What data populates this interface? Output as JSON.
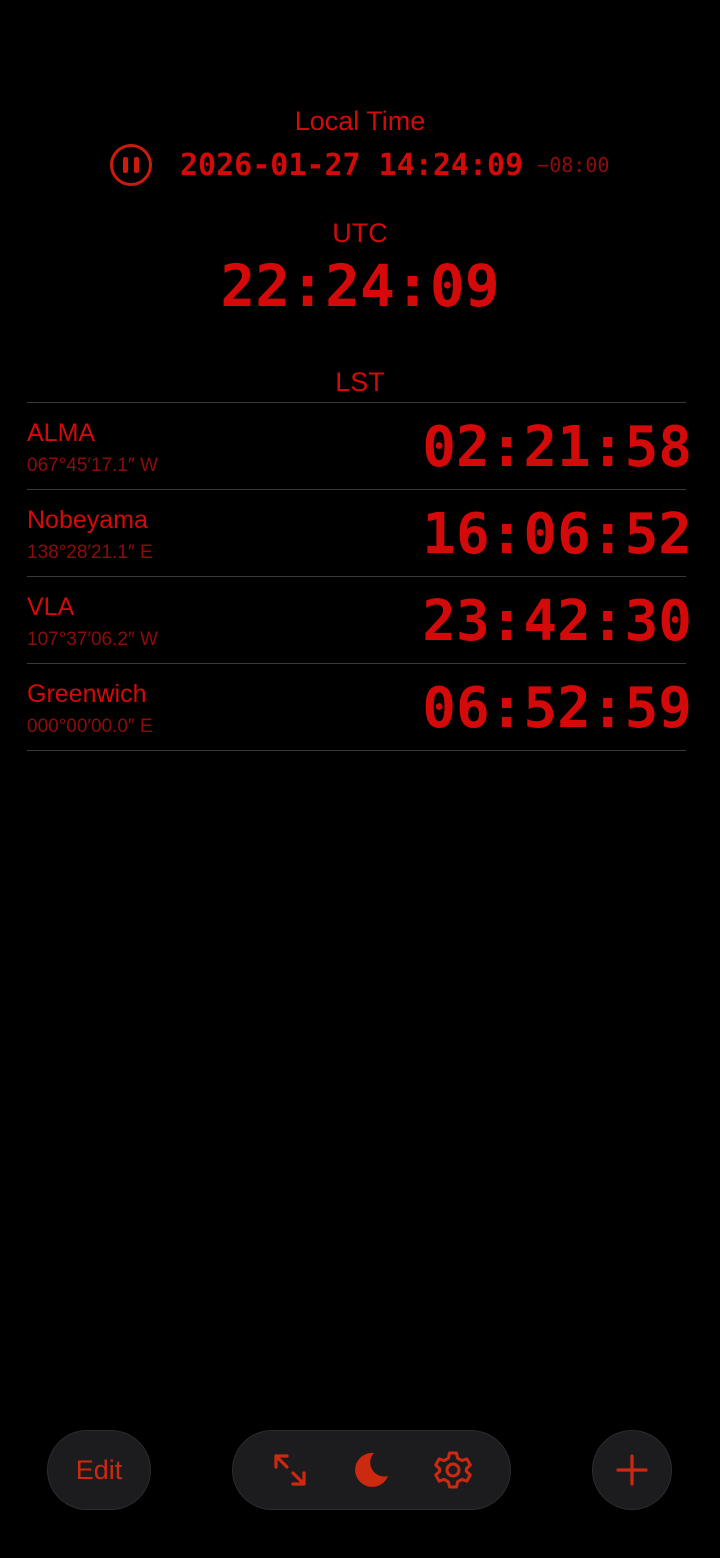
{
  "local": {
    "label": "Local Time",
    "datetime": "2026-01-27 14:24:09",
    "offset": "−08:00",
    "pause_icon": "pause-icon"
  },
  "utc": {
    "label": "UTC",
    "time": "22:24:09"
  },
  "lst": {
    "label": "LST",
    "sites": [
      {
        "name": "ALMA",
        "longitude": "067°45′17.1″ W",
        "lst": "02:21:58"
      },
      {
        "name": "Nobeyama",
        "longitude": "138°28′21.1″ E",
        "lst": "16:06:52"
      },
      {
        "name": "VLA",
        "longitude": "107°37′06.2″ W",
        "lst": "23:42:30"
      },
      {
        "name": "Greenwich",
        "longitude": "000°00′00.0″ E",
        "lst": "06:52:59"
      }
    ]
  },
  "toolbar": {
    "edit_label": "Edit",
    "icons": [
      "expand-icon",
      "moon-icon",
      "gear-icon",
      "plus-icon"
    ]
  },
  "colors": {
    "accent": "#d40a0a",
    "dim": "#8e0c0c",
    "icon": "#cc2a10",
    "background": "#000000",
    "button_bg": "#1c1c1e"
  }
}
